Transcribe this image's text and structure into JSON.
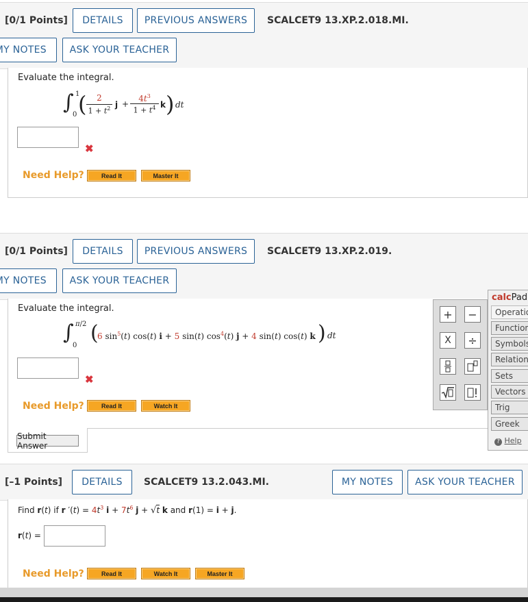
{
  "questions": [
    {
      "points": "[0/1 Points]",
      "details": "DETAILS",
      "previous": "PREVIOUS ANSWERS",
      "code": "SCALCET9 13.XP.2.018.MI.",
      "my_notes": "MY NOTES",
      "ask": "ASK YOUR TEACHER",
      "prompt": "Evaluate the integral.",
      "need_help": "Need Help?",
      "help_buttons": [
        "Read It",
        "Master It"
      ]
    },
    {
      "points": "[0/1 Points]",
      "details": "DETAILS",
      "previous": "PREVIOUS ANSWERS",
      "code": "SCALCET9 13.XP.2.019.",
      "my_notes": "MY NOTES",
      "ask": "ASK YOUR TEACHER",
      "prompt": "Evaluate the integral.",
      "need_help": "Need Help?",
      "help_buttons": [
        "Read It",
        "Watch It"
      ],
      "submit": "Submit Answer"
    },
    {
      "points": "[–1 Points]",
      "details": "DETAILS",
      "code": "SCALCET9 13.2.043.MI.",
      "my_notes": "MY NOTES",
      "ask": "ASK YOUR TEACHER",
      "need_help": "Need Help?",
      "help_buttons": [
        "Read It",
        "Watch It",
        "Master It"
      ],
      "answer_label": "r(t) ="
    }
  ],
  "calcpad": {
    "title_a": "calc",
    "title_b": "Pad",
    "keys": [
      "+",
      "−",
      "X",
      "÷",
      "·",
      "▯□",
      "√▯",
      "▯!"
    ],
    "tabs": [
      "Operations",
      "Functions",
      "Symbols",
      "Relations",
      "Sets",
      "Vectors",
      "Trig",
      "Greek"
    ],
    "help": "Help"
  },
  "colors": {
    "accent": "#2a6296",
    "help_orange": "#e89a2a",
    "error_red": "#d9363e"
  }
}
